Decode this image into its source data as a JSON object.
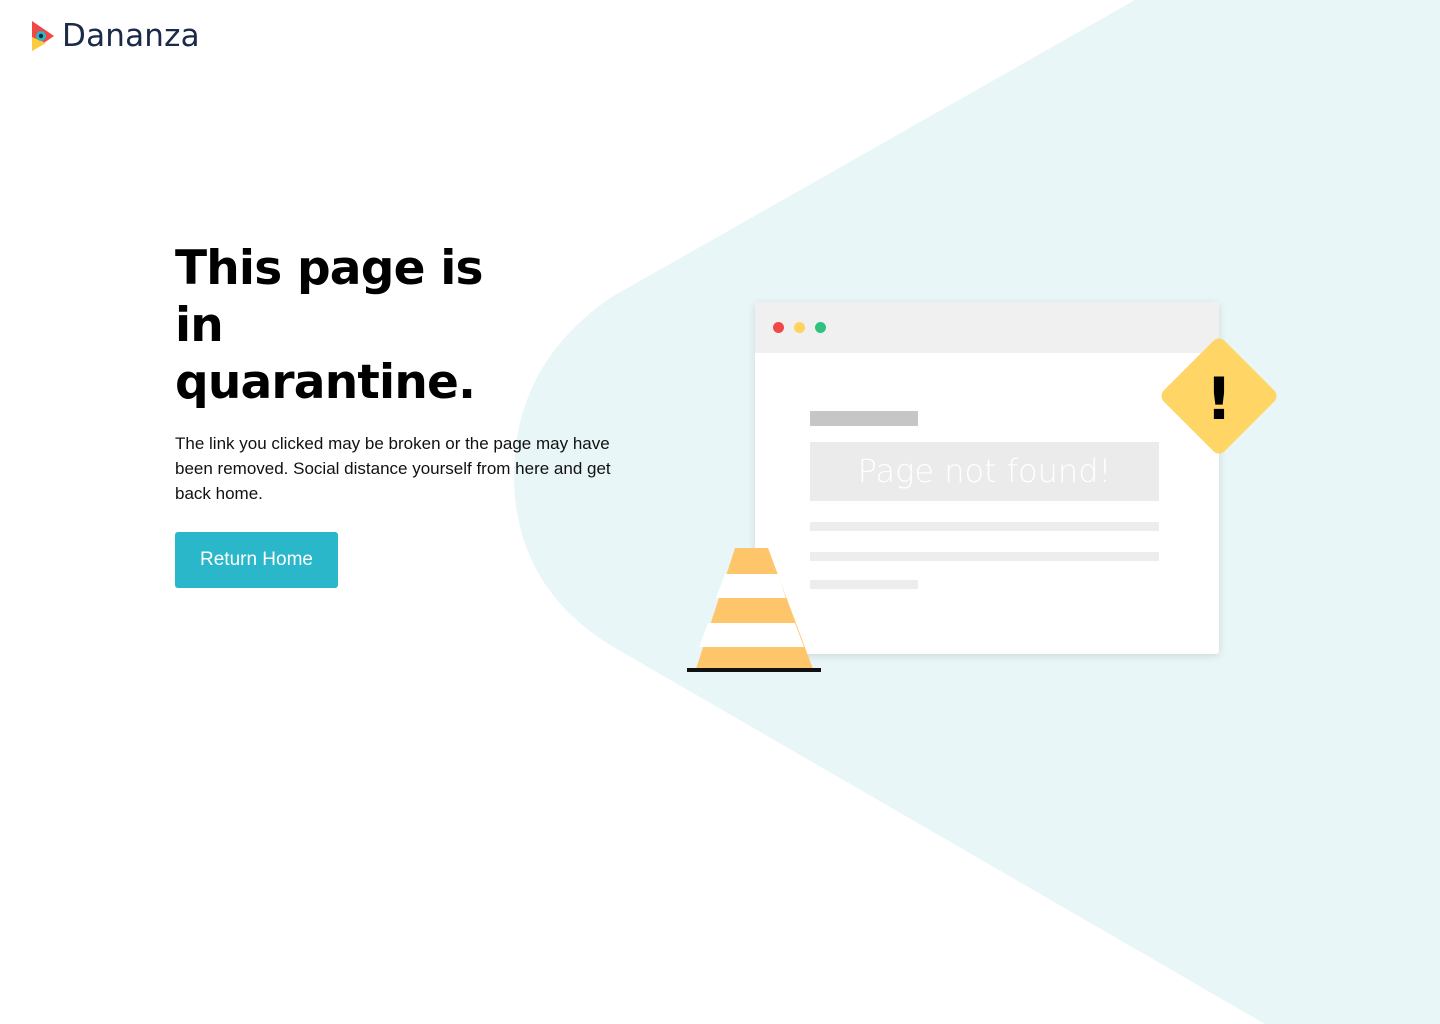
{
  "brand": {
    "name": "Dananza",
    "logo_colors": [
      "#f04747",
      "#ffc93c",
      "#2ab7ca",
      "#1b2a49"
    ]
  },
  "hero": {
    "title": "This page is in quarantine.",
    "description": "The link you clicked may be broken or the page may have been removed. Social distance yourself from here and get back home.",
    "button_label": "Return Home"
  },
  "illustration": {
    "browser_banner_text": "Page not found!",
    "warning_symbol": "!",
    "icons": [
      "browser-window-icon",
      "warning-diamond-icon",
      "traffic-cone-icon"
    ]
  },
  "colors": {
    "accent": "#2ab7ca",
    "background_shape": "#e8f6f7",
    "warning": "#ffd666",
    "cone": "#ffc56b"
  }
}
